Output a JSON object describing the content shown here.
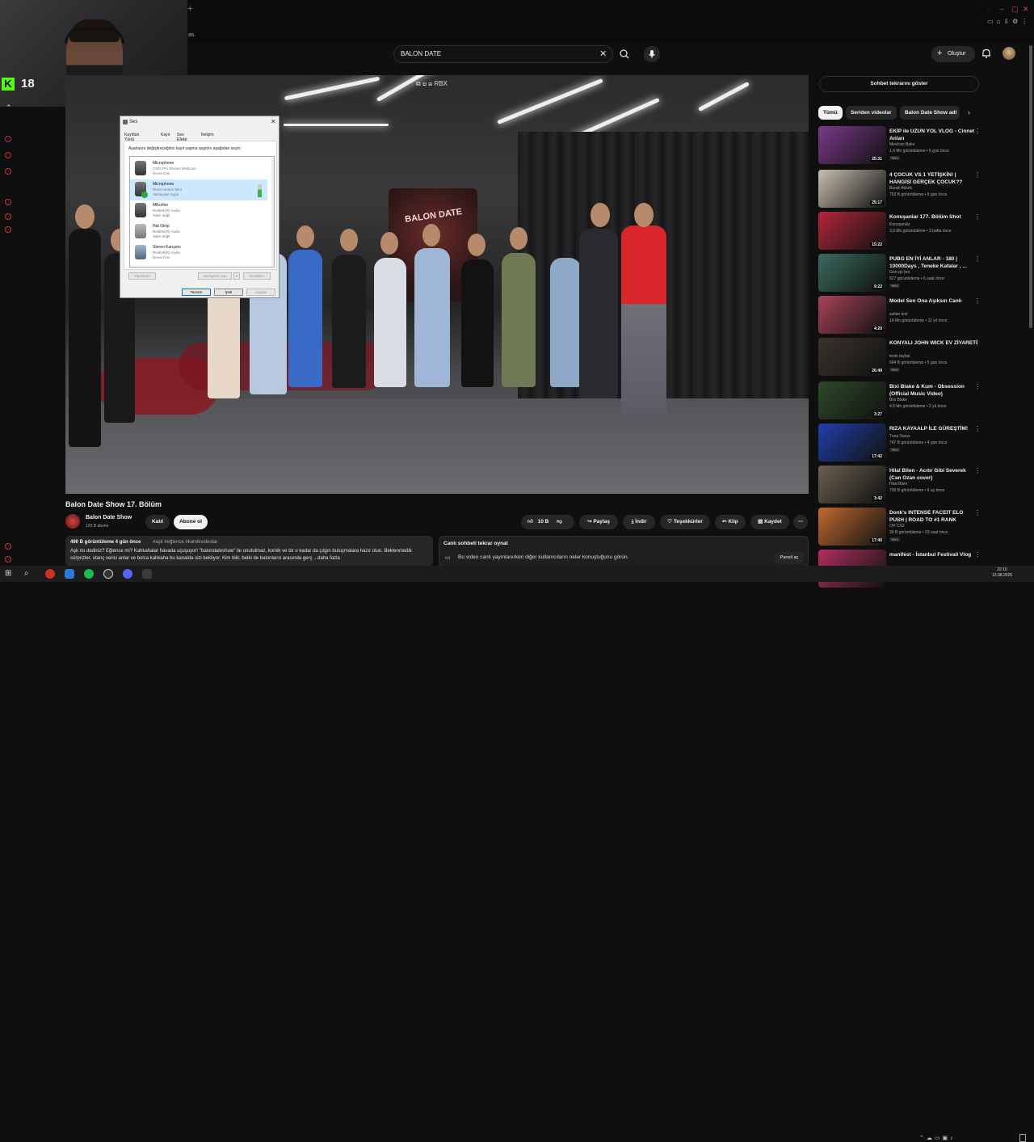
{
  "overlay": {
    "viewer_count": "18",
    "tab_fragment": "as."
  },
  "header": {
    "search_value": "BALON DATE",
    "create_label": "Oluştur"
  },
  "player": {
    "logo_text": "BALON DATE"
  },
  "sound_dialog": {
    "title": "Ses",
    "tabs": [
      "Kayıttan Yürüt",
      "Kayıt",
      "Ses Efekti",
      "İletişim"
    ],
    "instruction": "Ayarlarını değiştireceğiniz kayıt yapma aygıtını aşağıdan seçin:",
    "devices": [
      {
        "name": "Microphone",
        "sub": "C922 Pro Stream Webcam",
        "state": "Devre Dışı"
      },
      {
        "name": "Microphone",
        "sub": "Razer Seiren Mini",
        "state": "Varsayılan Aygıt"
      },
      {
        "name": "Mikrofon",
        "sub": "Realtek(R) Audio",
        "state": "Takılı değil"
      },
      {
        "name": "Hat Girişi",
        "sub": "Realtek(R) Audio",
        "state": "Takılı değil"
      },
      {
        "name": "Stereo Karışımı",
        "sub": "Realtek(R) Audio",
        "state": "Devre Dışı"
      }
    ],
    "buttons": {
      "configure": "Yapılandır",
      "set_default": "Varsayılan yap",
      "properties": "Özellikler",
      "ok": "Tamam",
      "cancel": "İptal",
      "apply": "Uygula"
    }
  },
  "video": {
    "title": "Balon Date Show 17. Bölüm",
    "channel": "Balon Date Show",
    "subscribers": "120 B abone",
    "join_label": "Katıl",
    "subscribe_label": "Abone ol",
    "like_count": "10 B",
    "share_label": "Paylaş",
    "download_label": "İndir",
    "thanks_label": "Teşekkürler",
    "clip_label": "Klip",
    "save_label": "Kaydet",
    "desc_meta": "490 B görüntüleme  4 gün önce",
    "desc_tags": "#aşk #eğlence #komikvideolar",
    "desc_text": "Aşk mı dediniz? Eğlence mi? Kahkahalar havada uçuşuyor! \"balondateshow\" ile unutulmaz, komik ve bir o kadar da çılgın buluşmalara hazır olun. Beklenmedik sürprizler, utanç verici anlar ve bolca kahkaha bu kanalda sizi bekliyor. Kim bilir, belki de balonların arasında gerç  ...daha fazla"
  },
  "chat_replay": {
    "title": "Canlı sohbeti tekrar oynat",
    "description": "Bu video canlı yayınlanırken diğer kullanıcıların neler konuştuğunu görün.",
    "button": "Paneli aç"
  },
  "sidebar": {
    "show_chat": "Sohbet tekrarını göster",
    "chips": [
      "Tümü",
      "Seriden videolar",
      "Balon Date Show adl"
    ],
    "recommendations": [
      {
        "title": "EKİP ile UZUN YOL VLOG - Cinnet Anları",
        "channel": "Mevlcan Bakır",
        "meta": "1,4 Mn görüntüleme • 6 gün önce",
        "new": "Yeni",
        "duration": "25:31",
        "color": "#7a3a8a"
      },
      {
        "title": "4 ÇOCUK VS 1 YETİŞKİN! | HANGİSİ GERÇEK ÇOCUK??",
        "channel": "Burak Akbirk",
        "meta": "763 B görüntüleme • 9 gün önce",
        "new": "",
        "duration": "25:17",
        "color": "#c9c0b0"
      },
      {
        "title": "Konuşanlar 177. Bölüm Shot",
        "channel": "Konuşanlar",
        "meta": "3,9 Mn görüntüleme • 3 hafta önce",
        "new": "",
        "duration": "15:22",
        "color": "#b3263a"
      },
      {
        "title": "PUBG EN İYİ ANLAR - 180 | 10000Days , Teneke Kafalar , ...",
        "channel": "Goo-go bro.",
        "meta": "827 görüntüleme • 6 saat önce",
        "new": "Yeni",
        "duration": "9:22",
        "color": "#3b6a5e"
      },
      {
        "title": "Model  Sen Ona Aşıksın Canlı",
        "channel": "sultan krsl",
        "meta": "14 Mn görüntüleme • 11 yıl önce",
        "new": "",
        "duration": "4:20",
        "color": "#a8445a"
      },
      {
        "title": "KONYALI JOHN WICK EV ZİYARETİ",
        "channel": "testo taylan",
        "meta": "604 B görüntüleme • 5 gün önce",
        "new": "Yeni",
        "duration": "26:49",
        "color": "#3a332c"
      },
      {
        "title": "Bixi Blake & Kum - Obsession (Official Music Video)",
        "channel": "Bixi Blake",
        "meta": "4,9 Mn görüntüleme • 2 yıl önce",
        "new": "",
        "duration": "3:27",
        "color": "#2e4a2a"
      },
      {
        "title": "RIZA KAYAALP İLE GÜREŞTİM!",
        "channel": "Tuna Tavus",
        "meta": "747 B görüntüleme • 4 gün önce",
        "new": "Yeni",
        "duration": "17:42",
        "color": "#2040a8"
      },
      {
        "title": "Hilal Bilen - Acıtır Gibi Severek (Can Ozan cover)",
        "channel": "Hilal Bilen",
        "meta": "700 B görüntüleme • 6 ay önce",
        "new": "",
        "duration": "3:42",
        "color": "#6a6050"
      },
      {
        "title": "Donk's INTENSE FACEIT ELO PUSH | ROAD TO #1 RANK",
        "channel": "OH CS2",
        "meta": "30 B görüntüleme • 23 saat önce",
        "new": "Yeni",
        "duration": "17:40",
        "color": "#c06a30"
      },
      {
        "title": "manifest - İstanbul Festivali Vlog",
        "channel": "",
        "meta": "",
        "new": "",
        "duration": "",
        "color": "#b03060"
      }
    ]
  },
  "taskbar": {
    "time": "22:10",
    "date": "12.08.2025"
  },
  "icons": [
    "close-icon",
    "search-icon",
    "mic-icon",
    "bell-icon",
    "plus-icon",
    "like-icon",
    "dislike-icon",
    "share-icon",
    "download-icon",
    "thanks-icon",
    "clip-icon",
    "save-icon",
    "more-icon",
    "chat-icon",
    "chevron-right-icon",
    "windows-start-icon"
  ]
}
